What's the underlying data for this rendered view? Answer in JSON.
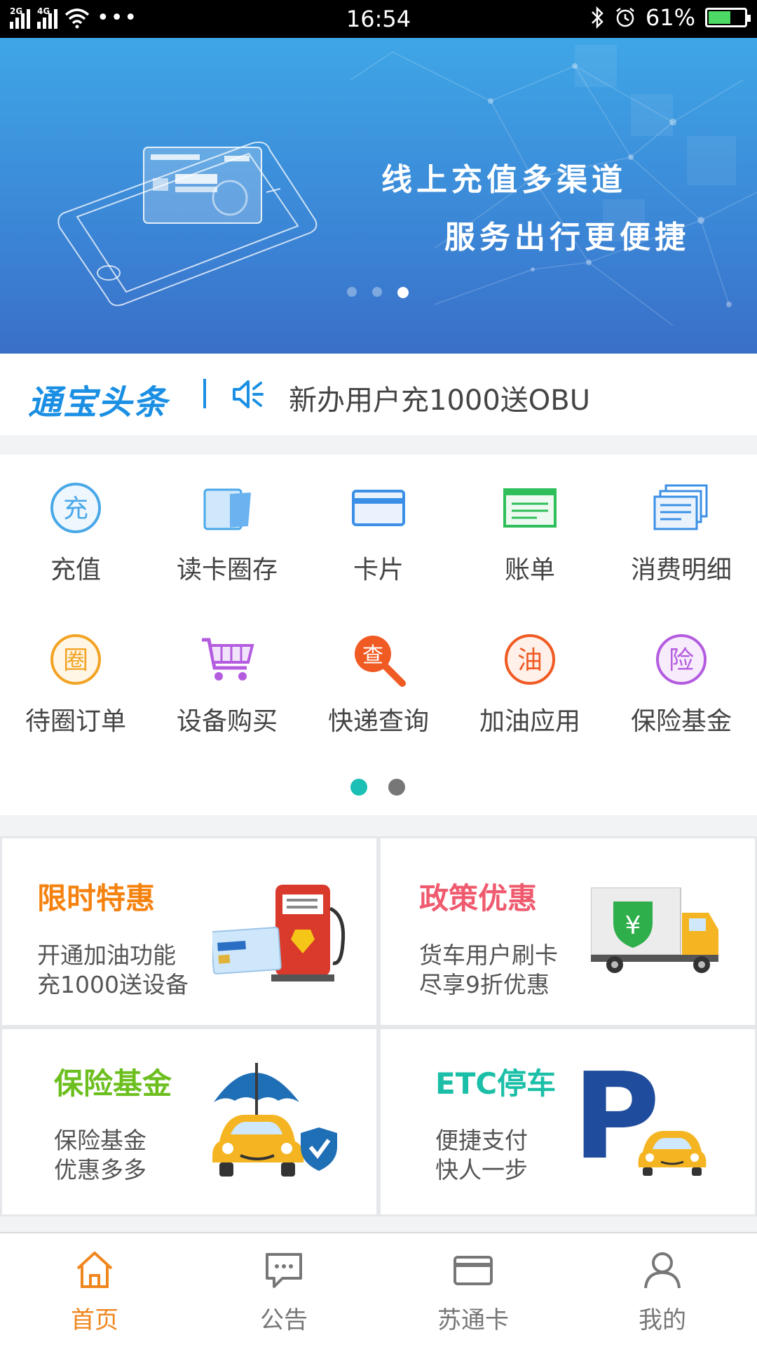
{
  "status_bar": {
    "network_1": "2G",
    "network_2": "4G",
    "time": "16:54",
    "battery_level": "61%",
    "battery_fraction": 0.61
  },
  "banner": {
    "line1": "线上充值多渠道",
    "line2": "服务出行更便捷",
    "page_count": 3,
    "active_page": 3
  },
  "ticker": {
    "logo": "通宝头条",
    "text": "新办用户充1000送OBU"
  },
  "menu": {
    "items": [
      {
        "label": "充值",
        "icon": "recharge-icon",
        "glyph": "充",
        "color": "#4aa8e8"
      },
      {
        "label": "读卡圈存",
        "icon": "card-reader-icon",
        "color": "#4aa8e8"
      },
      {
        "label": "卡片",
        "icon": "card-icon",
        "color": "#3b8fe6"
      },
      {
        "label": "账单",
        "icon": "bill-icon",
        "color": "#2fbf5a"
      },
      {
        "label": "消费明细",
        "icon": "details-icon",
        "color": "#3b8fe6"
      },
      {
        "label": "待圈订单",
        "icon": "pending-order-icon",
        "glyph": "圈",
        "color": "#f2a324"
      },
      {
        "label": "设备购买",
        "icon": "cart-icon",
        "color": "#b45ce0"
      },
      {
        "label": "快递查询",
        "icon": "search-query-icon",
        "glyph": "查",
        "color": "#f05a23"
      },
      {
        "label": "加油应用",
        "icon": "fuel-icon",
        "glyph": "油",
        "color": "#f05a23"
      },
      {
        "label": "保险基金",
        "icon": "insurance-icon",
        "glyph": "险",
        "color": "#b45ce0"
      }
    ],
    "page_count": 2,
    "active_page": 1
  },
  "promos": [
    {
      "title": "限时特惠",
      "line1": "开通加油功能",
      "line2": "充1000送设备",
      "color": "#f5820f",
      "icon": "fuel-pump-card-icon"
    },
    {
      "title": "政策优惠",
      "line1": "货车用户刷卡",
      "line2": "尽享9折优惠",
      "color": "#ef5a6e",
      "icon": "truck-icon"
    },
    {
      "title": "保险基金",
      "line1": "保险基金",
      "line2": "优惠多多",
      "color": "#6cbf1e",
      "icon": "umbrella-car-icon"
    },
    {
      "title": "ETC停车",
      "line1": "便捷支付",
      "line2": "快人一步",
      "color": "#1bbfa7",
      "icon": "parking-car-icon",
      "parking_letter": "P"
    }
  ],
  "tabbar": {
    "tabs": [
      {
        "label": "首页",
        "icon": "home-icon",
        "active": true
      },
      {
        "label": "公告",
        "icon": "message-icon",
        "active": false
      },
      {
        "label": "苏通卡",
        "icon": "card-tab-icon",
        "active": false
      },
      {
        "label": "我的",
        "icon": "profile-icon",
        "active": false
      }
    ],
    "active_color": "#f0861e",
    "inactive_color": "#777777"
  }
}
